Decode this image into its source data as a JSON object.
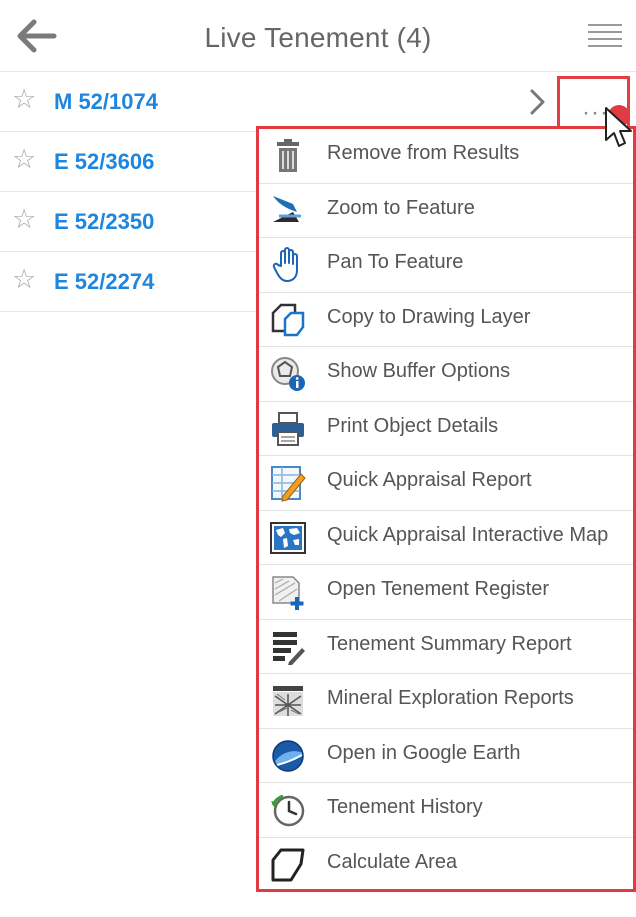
{
  "header": {
    "title": "Live Tenement (4)"
  },
  "tenements": [
    {
      "id": "M 52/1074"
    },
    {
      "id": "E 52/3606"
    },
    {
      "id": "E 52/2350"
    },
    {
      "id": "E 52/2274"
    }
  ],
  "row_actions": {
    "more_glyph": "···"
  },
  "context_menu": {
    "items": [
      {
        "label": "Remove from Results",
        "icon": "trash-icon"
      },
      {
        "label": "Zoom to Feature",
        "icon": "zoom-to-feature-icon"
      },
      {
        "label": "Pan To Feature",
        "icon": "hand-pan-icon"
      },
      {
        "label": "Copy to Drawing Layer",
        "icon": "copy-drawing-icon"
      },
      {
        "label": "Show Buffer Options",
        "icon": "buffer-info-icon"
      },
      {
        "label": "Print Object Details",
        "icon": "printer-icon"
      },
      {
        "label": "Quick Appraisal Report",
        "icon": "report-edit-icon"
      },
      {
        "label": "Quick Appraisal Interactive Map",
        "icon": "world-map-icon"
      },
      {
        "label": "Open Tenement Register",
        "icon": "register-add-icon"
      },
      {
        "label": "Tenement Summary Report",
        "icon": "summary-report-icon"
      },
      {
        "label": "Mineral Exploration Reports",
        "icon": "wamex-icon"
      },
      {
        "label": "Open in Google Earth",
        "icon": "google-earth-icon"
      },
      {
        "label": "Tenement History",
        "icon": "history-clock-icon"
      },
      {
        "label": "Calculate Area",
        "icon": "polygon-area-icon"
      }
    ]
  },
  "colors": {
    "link_blue": "#1f86e0",
    "highlight_red": "#e23a43",
    "text_gray": "#555555"
  }
}
